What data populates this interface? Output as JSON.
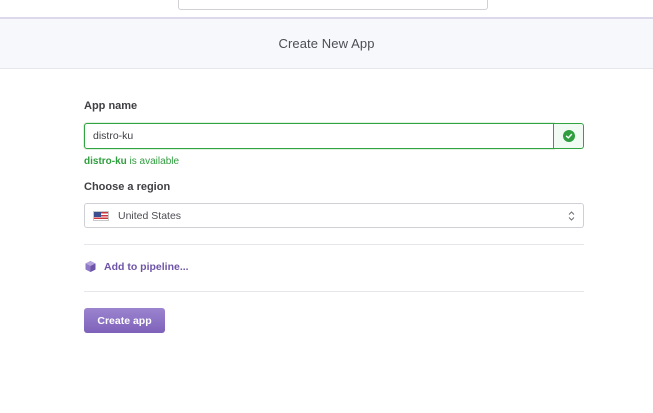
{
  "header": {
    "title": "Create New App"
  },
  "form": {
    "app_name_label": "App name",
    "app_name_value": "distro-ku",
    "availability": {
      "name": "distro-ku",
      "suffix": " is available"
    },
    "region_label": "Choose a region",
    "region_value": "United States",
    "pipeline_link": "Add to pipeline...",
    "create_button": "Create app"
  },
  "colors": {
    "accent_purple": "#7e62ba",
    "success_green": "#2f9e3e"
  },
  "icons": {
    "status": "check-circle-icon",
    "region": "us-flag-icon",
    "select": "chevron-updown-icon",
    "pipeline": "pipeline-cube-icon"
  }
}
